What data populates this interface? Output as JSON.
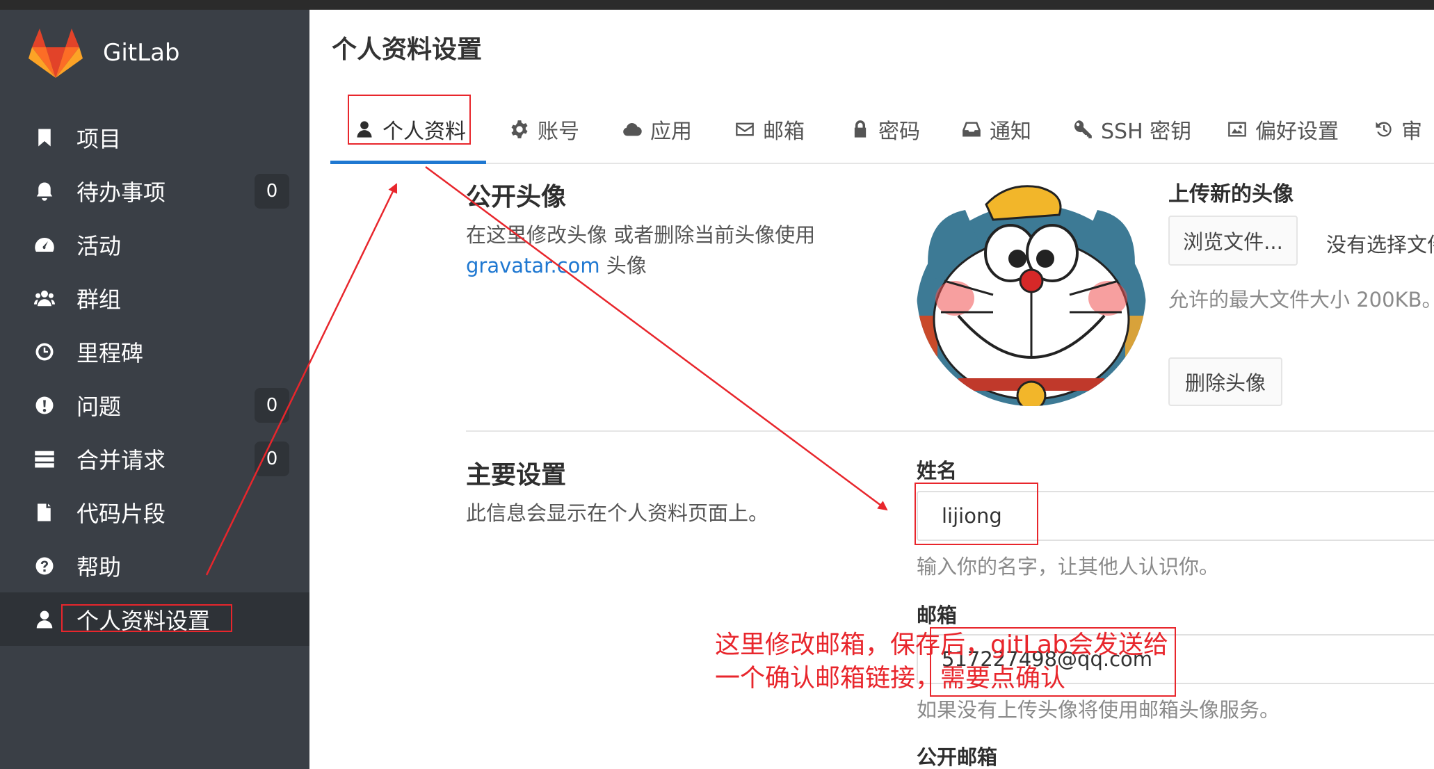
{
  "app": {
    "name": "GitLab"
  },
  "sidebar": {
    "items": [
      {
        "label": "项目",
        "icon": "bookmark-icon"
      },
      {
        "label": "待办事项",
        "icon": "bell-icon",
        "count": "0"
      },
      {
        "label": "活动",
        "icon": "dashboard-icon"
      },
      {
        "label": "群组",
        "icon": "users-icon"
      },
      {
        "label": "里程碑",
        "icon": "clock-icon"
      },
      {
        "label": "问题",
        "icon": "exclamation-icon",
        "count": "0"
      },
      {
        "label": "合并请求",
        "icon": "tasks-icon",
        "count": "0"
      },
      {
        "label": "代码片段",
        "icon": "clipboard-icon"
      },
      {
        "label": "帮助",
        "icon": "question-icon"
      },
      {
        "label": "个人资料设置",
        "icon": "user-icon",
        "active": true
      }
    ]
  },
  "page": {
    "title": "个人资料设置"
  },
  "tabs": [
    {
      "label": "个人资料",
      "icon": "user-icon",
      "active": true
    },
    {
      "label": "账号",
      "icon": "gear-icon"
    },
    {
      "label": "应用",
      "icon": "cloud-icon"
    },
    {
      "label": "邮箱",
      "icon": "envelope-icon"
    },
    {
      "label": "密码",
      "icon": "lock-icon"
    },
    {
      "label": "通知",
      "icon": "inbox-icon"
    },
    {
      "label": "SSH 密钥",
      "icon": "key-icon"
    },
    {
      "label": "偏好设置",
      "icon": "image-icon"
    },
    {
      "label": "审",
      "icon": "history-icon"
    }
  ],
  "avatar_section": {
    "title": "公开头像",
    "desc_line1": "在这里修改头像 或者删除当前头像使用",
    "desc_link": "gravatar.com",
    "desc_suffix": " 头像",
    "upload_title": "上传新的头像",
    "browse_button": "浏览文件...",
    "no_file": "没有选择文件",
    "max_size": "允许的最大文件大小 200KB。",
    "remove_button": "删除头像"
  },
  "main_settings": {
    "title": "主要设置",
    "desc": "此信息会显示在个人资料页面上。",
    "name_label": "姓名",
    "name_value": "lijiong",
    "name_help": "输入你的名字，让其他人认识你。",
    "email_label": "邮箱",
    "email_value": "517227498@qq.com",
    "email_help": "如果没有上传头像将使用邮箱头像服务。",
    "public_email_label": "公开邮箱"
  },
  "annotation": {
    "line1": "这里修改邮箱，保存后，gitLab会发送给",
    "line2": "一个确认邮箱链接，需要点确认",
    "color": "#e8262c"
  },
  "colors": {
    "sidebar_bg": "#3a3f46",
    "accent": "#1f78d1",
    "annotation_red": "#e8262c"
  }
}
